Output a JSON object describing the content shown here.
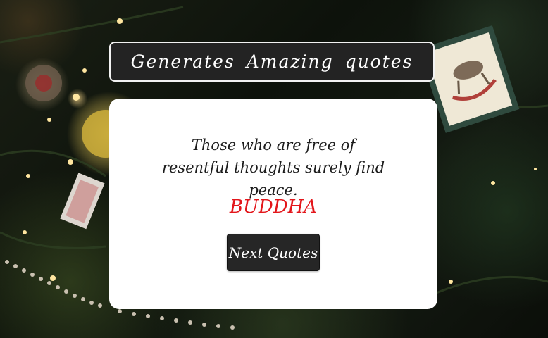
{
  "header": {
    "title": "Generates Amazing quotes"
  },
  "quote": {
    "text": "Those who are free of resentful thoughts surely find peace.",
    "author": "BUDDHA"
  },
  "actions": {
    "next_label": "Next Quotes"
  },
  "colors": {
    "title_bar_bg": "#232323",
    "card_bg": "#ffffff",
    "author": "#e3161b",
    "button_bg": "#262626"
  },
  "background": {
    "image": "christmas-tree-photo"
  }
}
